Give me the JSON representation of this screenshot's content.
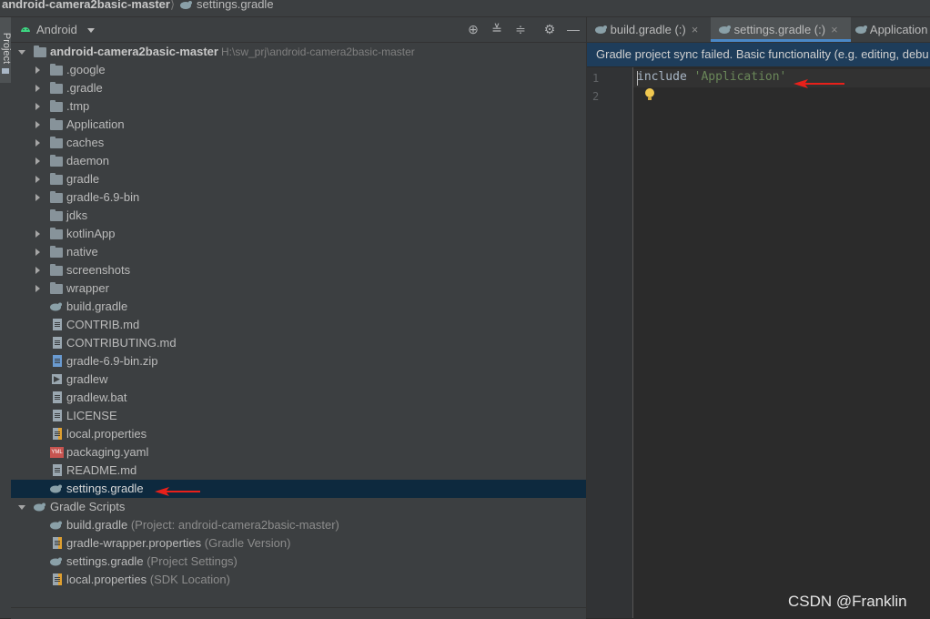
{
  "breadcrumb": {
    "project": "android-camera2basic-master",
    "separator": "⟩",
    "file": "settings.gradle"
  },
  "left_stripe": {
    "project_tab": "Project"
  },
  "project_panel": {
    "view_mode": "Android",
    "toolbar_icons": [
      "locate-icon",
      "expand-all-icon",
      "collapse-all-icon",
      "gear-icon",
      "minimize-icon"
    ],
    "root": {
      "name": "android-camera2basic-master",
      "path": "H:\\sw_prj\\android-camera2basic-master"
    },
    "folders": [
      ".google",
      ".gradle",
      ".tmp",
      "Application",
      "caches",
      "daemon",
      "gradle",
      "gradle-6.9-bin",
      "jdks",
      "kotlinApp",
      "native",
      "screenshots",
      "wrapper"
    ],
    "files": [
      "build.gradle",
      "CONTRIB.md",
      "CONTRIBUTING.md",
      "gradle-6.9-bin.zip",
      "gradlew",
      "gradlew.bat",
      "LICENSE",
      "local.properties",
      "packaging.yaml",
      "README.md",
      "settings.gradle"
    ],
    "gradle_scripts": {
      "label": "Gradle Scripts",
      "items": [
        {
          "name": "build.gradle",
          "hint": "(Project: android-camera2basic-master)"
        },
        {
          "name": "gradle-wrapper.properties",
          "hint": "(Gradle Version)"
        },
        {
          "name": "settings.gradle",
          "hint": "(Project Settings)"
        },
        {
          "name": "local.properties",
          "hint": "(SDK Location)"
        }
      ]
    }
  },
  "editor": {
    "tabs": [
      {
        "label": "build.gradle (:)",
        "close": "×"
      },
      {
        "label": "settings.gradle (:)",
        "close": "×"
      },
      {
        "label": "Application"
      }
    ],
    "banner": "Gradle project sync failed. Basic functionality (e.g. editing, debu",
    "line_numbers": [
      "1",
      "2"
    ],
    "code": {
      "keyword": "include",
      "string": "'Application'"
    }
  },
  "watermark": "CSDN @Franklin",
  "colors": {
    "selection": "#0d293e",
    "banner": "#1e3d5b",
    "annotation_arrow": "#e8201a",
    "string": "#6a8759"
  }
}
